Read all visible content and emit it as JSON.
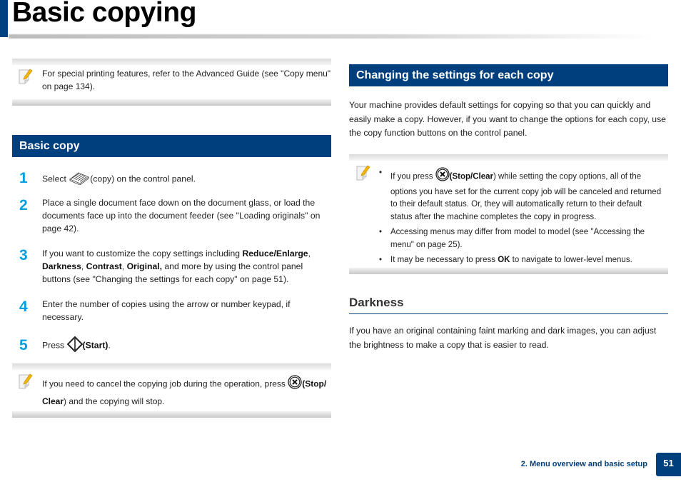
{
  "page": {
    "title": "Basic copying",
    "footer_chapter": "2. Menu overview and basic setup",
    "page_number": "51",
    "colors": {
      "brand_blue": "#003f7d",
      "step_number": "#00a0e0"
    }
  },
  "left": {
    "note1": {
      "icon": "note-pencil-icon",
      "text": "For special printing features, refer to the Advanced Guide (see \"Copy menu\" on page 134)."
    },
    "section": {
      "title": "Basic copy"
    },
    "steps": [
      {
        "num": "1",
        "pre": "Select ",
        "icon": "copy-icon",
        "post": "(copy) on the control panel."
      },
      {
        "num": "2",
        "text": "Place a single document face down on the document glass, or load the documents face up into the document feeder (see \"Loading originals\" on page 42)."
      },
      {
        "num": "3",
        "pre": "If you want to customize the copy settings including ",
        "b1": "Reduce/Enlarge",
        "c1": ", ",
        "b2": "Darkness",
        "c2": ", ",
        "b3": "Contrast",
        "c3": ", ",
        "b4": "Original,",
        "post": " and more by using the control panel buttons (see \"Changing the settings for each copy\" on page 51)."
      },
      {
        "num": "4",
        "text": "Enter the number of copies using the arrow or number keypad, if necessary."
      },
      {
        "num": "5",
        "pre": "Press ",
        "icon": "start-icon",
        "bold": "(Start)",
        "post": "."
      }
    ],
    "note2": {
      "icon": "note-pencil-icon",
      "pre": "If you need to cancel the copying job during the operation, press ",
      "stop_icon": "stop-clear-icon",
      "bold1": "(Stop/",
      "bold2": "Clear",
      "post": ") and the copying will stop."
    }
  },
  "right": {
    "section": {
      "title": "Changing the settings for each copy"
    },
    "intro": "Your machine provides default settings for copying so that you can quickly and easily make a copy. However, if you want to change the options for each copy, use the copy function buttons on the control panel.",
    "note": {
      "icon": "note-pencil-icon",
      "bullet_char": "•",
      "bullets": [
        {
          "pre": "If you press ",
          "icon": "stop-clear-icon",
          "bold": "(Stop/Clear",
          "post": ") while setting the copy options, all of the options you have set for the current copy job will be canceled and returned to their default status. Or, they will automatically return to their default status after the machine completes the copy in progress."
        },
        {
          "text": "Accessing menus may differ from model to model (see \"Accessing the menu\" on page 25)."
        },
        {
          "pre": "It may be necessary to press ",
          "bold": "OK",
          "post": " to navigate to lower-level menus."
        }
      ]
    },
    "darkness": {
      "heading": "Darkness",
      "text": "If you have an original containing faint marking and dark images, you can adjust the brightness to make a copy that is easier to read."
    }
  }
}
